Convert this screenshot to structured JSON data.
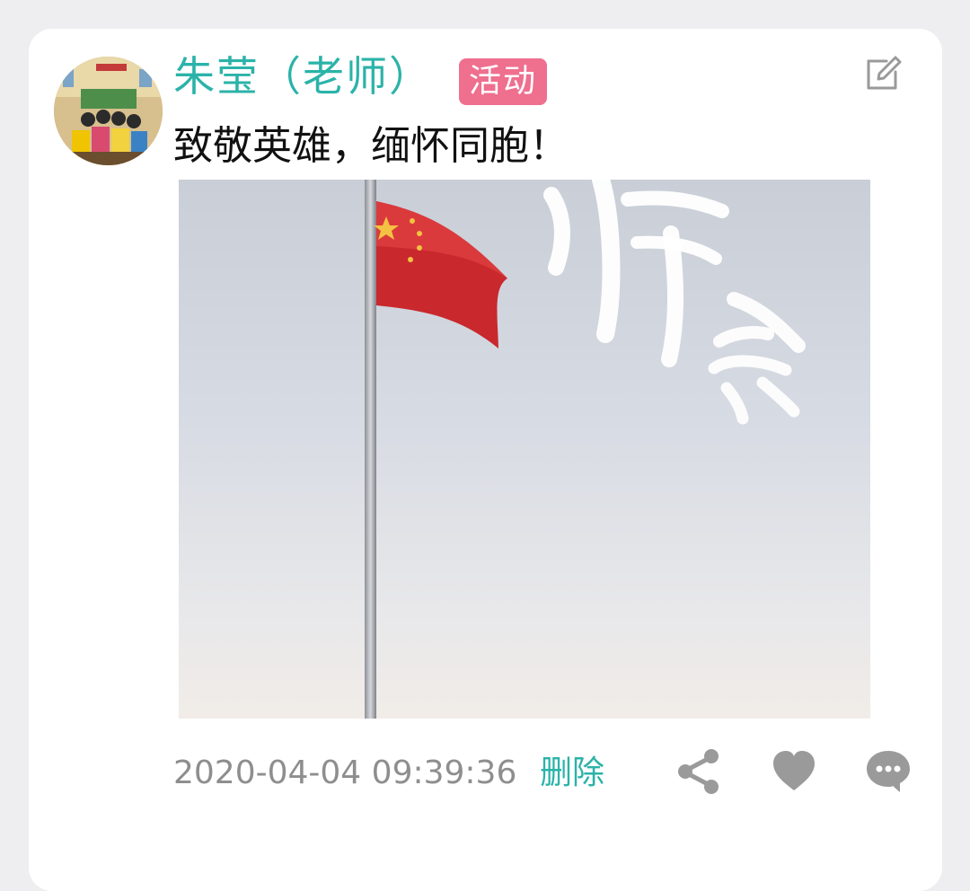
{
  "post": {
    "author": {
      "name": "朱莹（老师）",
      "avatar_icon": "classroom-photo"
    },
    "tag": {
      "label": "活动",
      "color": "#ef6f8f"
    },
    "text": "致敬英雄，缅怀同胞！",
    "image": {
      "description_icon": "flag-on-pole-photo",
      "overlay_text": "悼念"
    },
    "timestamp": "2020-04-04 09:39:36",
    "delete_label": "删除",
    "actions": {
      "edit_icon": "edit-icon",
      "share_icon": "share-icon",
      "like_icon": "heart-icon",
      "comment_icon": "comment-icon"
    }
  },
  "theme": {
    "accent": "#2bb3a9",
    "background": "#eeeef0",
    "card": "#ffffff",
    "icon_gray": "#9a9a9a"
  }
}
